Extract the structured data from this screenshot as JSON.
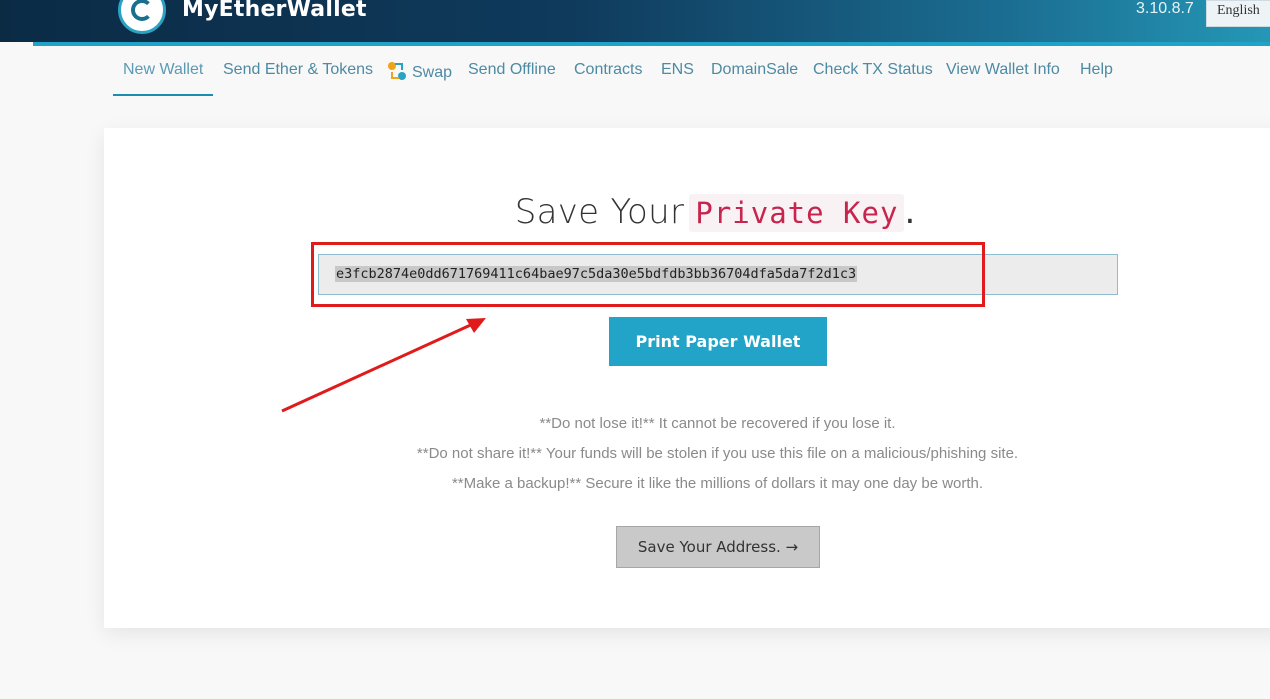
{
  "header": {
    "brand": "MyEtherWallet",
    "version": "3.10.8.7",
    "language": "English"
  },
  "nav": {
    "items": [
      {
        "label": "New Wallet",
        "active": true
      },
      {
        "label": "Send Ether & Tokens"
      },
      {
        "label": "Swap",
        "icon": "swap-icon"
      },
      {
        "label": "Send Offline"
      },
      {
        "label": "Contracts"
      },
      {
        "label": "ENS"
      },
      {
        "label": "DomainSale"
      },
      {
        "label": "Check TX Status"
      },
      {
        "label": "View Wallet Info"
      },
      {
        "label": "Help"
      }
    ]
  },
  "main": {
    "title_prefix": "Save Your",
    "title_code": "Private Key",
    "title_suffix": ".",
    "private_key": "e3fcb2874e0dd671769411c64bae97c5da30e5bdfdb3bb36704dfa5da7f2d1c3",
    "print_button": "Print Paper Wallet",
    "warnings": [
      "**Do not lose it!** It cannot be recovered if you lose it.",
      "**Do not share it!** Your funds will be stolen if you use this file on a malicious/phishing site.",
      "**Make a backup!** Secure it like the millions of dollars it may one day be worth."
    ],
    "save_address_button": "Save Your Address. →"
  },
  "colors": {
    "accent": "#21a4c7",
    "annotation": "#e01b1b",
    "code": "#c7254e"
  }
}
